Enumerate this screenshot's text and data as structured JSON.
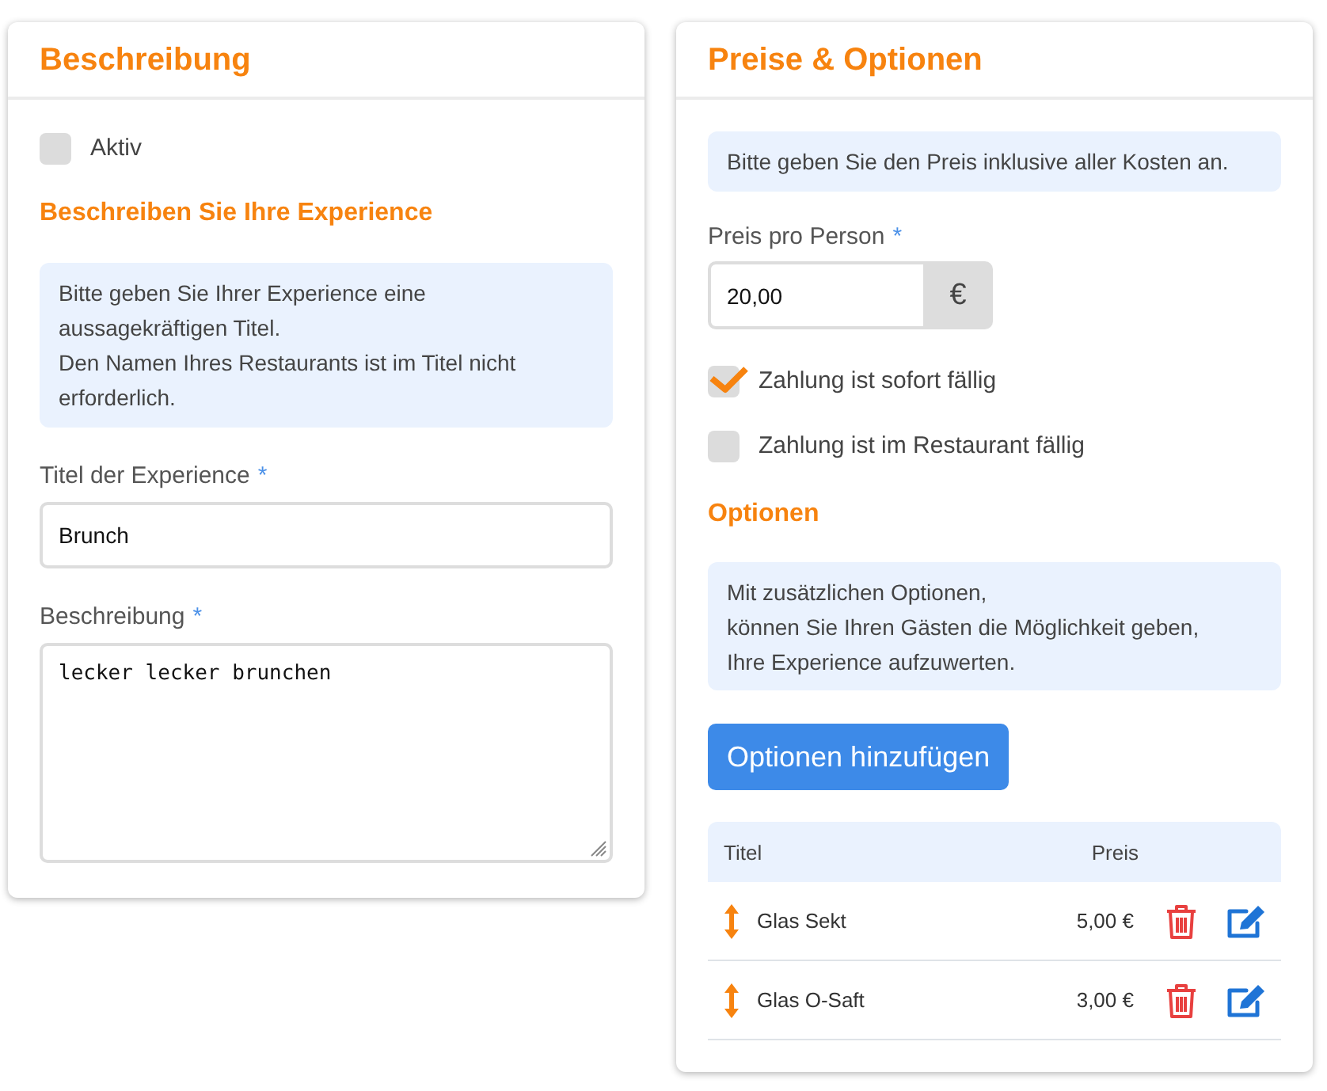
{
  "description_panel": {
    "title": "Beschreibung",
    "active": {
      "label": "Aktiv",
      "checked": false
    },
    "subheading": "Beschreiben Sie Ihre Experience",
    "info": "Bitte geben Sie Ihrer Experience eine aussagekräftigen Titel.\nDen Namen Ihres Restaurants ist im Titel nicht erforderlich.",
    "title_field": {
      "label": "Titel der Experience",
      "required_mark": "*",
      "value": "Brunch"
    },
    "description_field": {
      "label": "Beschreibung",
      "required_mark": "*",
      "value": "lecker lecker brunchen"
    }
  },
  "pricing_panel": {
    "title": "Preise & Optionen",
    "info": "Bitte geben Sie den Preis inklusive aller Kosten an.",
    "price_field": {
      "label": "Preis pro Person",
      "required_mark": "*",
      "value": "20,00",
      "currency": "€"
    },
    "payment_options": [
      {
        "label": "Zahlung ist sofort fällig",
        "checked": true
      },
      {
        "label": "Zahlung ist im Restaurant fällig",
        "checked": false
      }
    ],
    "options_heading": "Optionen",
    "options_info": "Mit zusätzlichen Optionen,\nkönnen Sie Ihren Gästen die Möglichkeit geben,\nIhre Experience aufzuwerten.",
    "add_button": "Optionen hinzufügen",
    "options_table": {
      "columns": [
        "Titel",
        "Preis"
      ],
      "rows": [
        {
          "title": "Glas Sekt",
          "price": "5,00 €"
        },
        {
          "title": "Glas O-Saft",
          "price": "3,00 €"
        }
      ]
    }
  }
}
